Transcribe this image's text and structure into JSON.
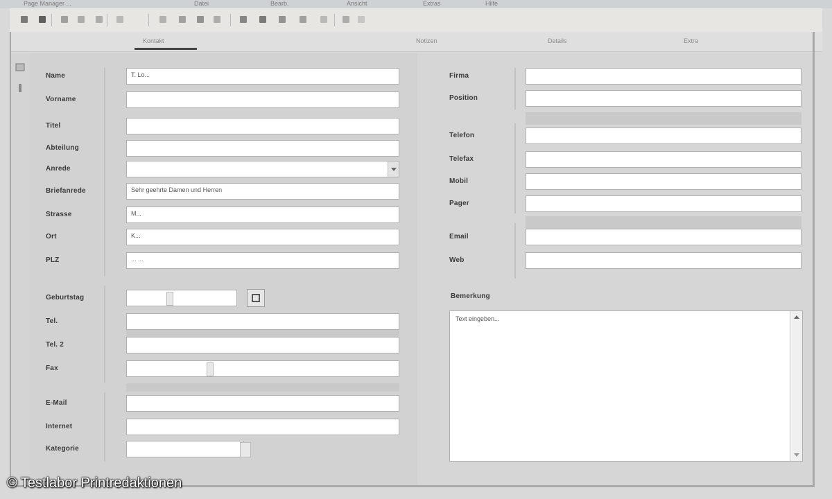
{
  "window": {
    "title": "Page Manager ...",
    "menu": [
      "Datei",
      "Bearb.",
      "Ansicht",
      "Extras",
      "Hilfe"
    ]
  },
  "toolbar": {
    "icons": [
      "pin-icon",
      "save-icon",
      "print-icon",
      "undo-icon",
      "redo-icon",
      "cut-icon",
      "copy-icon",
      "paste-icon",
      "find-icon",
      "new-icon",
      "delete-icon",
      "mail-icon",
      "export-icon",
      "import-icon",
      "settings-icon",
      "help-icon",
      "check-icon"
    ]
  },
  "tabs": [
    {
      "label": "Kontakt",
      "active": true
    },
    {
      "label": "Notizen",
      "active": false
    },
    {
      "label": "Details",
      "active": false
    },
    {
      "label": "Extra",
      "active": false
    }
  ],
  "left_form": [
    {
      "key": "name",
      "label": "Name",
      "value": "T. Lo..."
    },
    {
      "key": "vorname",
      "label": "Vorname",
      "value": ""
    },
    {
      "key": "titel",
      "label": "Titel",
      "value": ""
    },
    {
      "key": "abteilung",
      "label": "Abteilung",
      "value": ""
    },
    {
      "key": "anrede",
      "label": "Anrede",
      "value": "",
      "dropdown": true
    },
    {
      "key": "briefanrede",
      "label": "Briefanrede",
      "value": "Sehr geehrte Damen und Herren"
    },
    {
      "key": "strasse",
      "label": "Strasse",
      "value": "M..."
    },
    {
      "key": "ort",
      "label": "Ort",
      "value": "K..."
    },
    {
      "key": "plz",
      "label": "PLZ",
      "value": "... ..."
    },
    {
      "key": "geburtstag",
      "label": "Geburtstag",
      "value": ""
    },
    {
      "key": "tel1",
      "label": "Tel.",
      "value": ""
    },
    {
      "key": "tel2",
      "label": "Tel. 2",
      "value": ""
    },
    {
      "key": "fax",
      "label": "Fax",
      "value": ""
    },
    {
      "key": "email",
      "label": "E-Mail",
      "value": ""
    },
    {
      "key": "internet",
      "label": "Internet",
      "value": ""
    },
    {
      "key": "kategorie",
      "label": "Kategorie",
      "value": ""
    }
  ],
  "right_form": [
    {
      "key": "firma",
      "label": "Firma",
      "value": ""
    },
    {
      "key": "position",
      "label": "Position",
      "value": ""
    },
    {
      "key": "telefon1",
      "label": "Telefon",
      "value": ""
    },
    {
      "key": "telefon2",
      "label": "Telefax",
      "value": ""
    },
    {
      "key": "mobil",
      "label": "Mobil",
      "value": ""
    },
    {
      "key": "telefax",
      "label": "Pager",
      "value": ""
    },
    {
      "key": "email2",
      "label": "Email",
      "value": ""
    },
    {
      "key": "web",
      "label": "Web",
      "value": ""
    }
  ],
  "notes": {
    "label": "Bemerkung",
    "value": "Text eingeben..."
  },
  "watermark": "© Testlabor Printredaktionen"
}
